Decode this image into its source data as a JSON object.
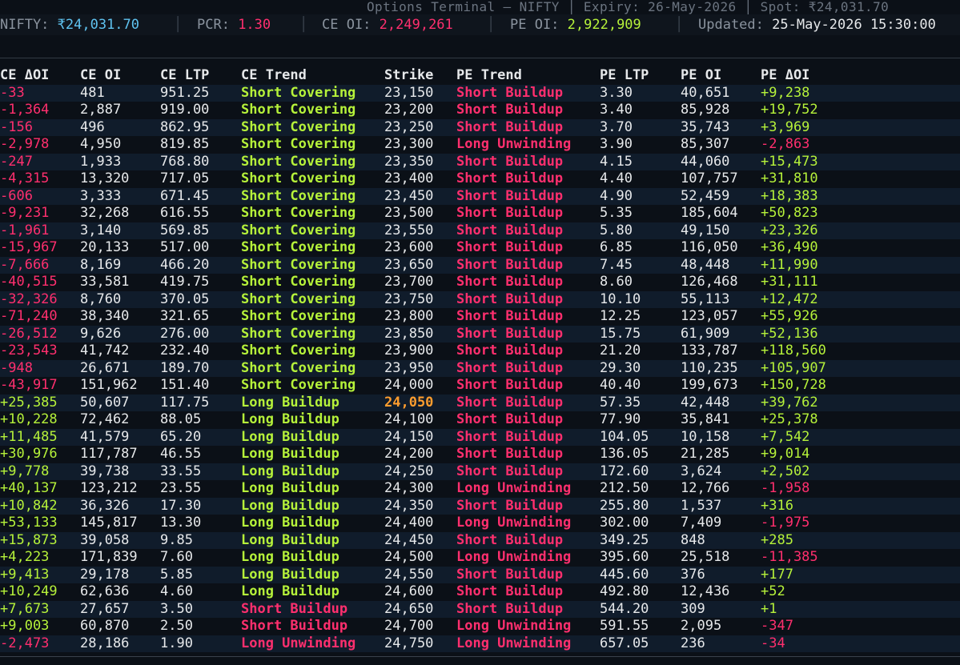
{
  "title": "Options Terminal — NIFTY │ Expiry: 26-May-2026 │ Spot: ₹24,031.70",
  "status": {
    "nifty_label": "NIFTY: ",
    "nifty_value": "₹24,031.70",
    "pcr_label": "PCR: ",
    "pcr_value": "1.30",
    "ce_oi_label": "CE OI: ",
    "ce_oi_value": "2,249,261",
    "pe_oi_label": "PE OI: ",
    "pe_oi_value": "2,922,909",
    "updated_label": "Updated: ",
    "updated_value": "25-May-2026 15:30:00",
    "separator": "│"
  },
  "colors": {
    "positive": "#b6f23a",
    "negative": "#ff2f6e",
    "atm_strike": "#ff9d2e",
    "spot": "#5fc3f0"
  },
  "columns": [
    "CE ΔOI",
    "CE OI",
    "CE LTP",
    "CE Trend",
    "Strike",
    "PE Trend",
    "PE LTP",
    "PE OI",
    "PE ΔOI"
  ],
  "atm_strike": "24,050",
  "rows": [
    [
      "-33",
      "481",
      "951.25",
      "Short Covering",
      "23,150",
      "Short Buildup",
      "3.30",
      "40,651",
      "+9,238"
    ],
    [
      "-1,364",
      "2,887",
      "919.00",
      "Short Covering",
      "23,200",
      "Short Buildup",
      "3.40",
      "85,928",
      "+19,752"
    ],
    [
      "-156",
      "496",
      "862.95",
      "Short Covering",
      "23,250",
      "Short Buildup",
      "3.70",
      "35,743",
      "+3,969"
    ],
    [
      "-2,978",
      "4,950",
      "819.85",
      "Short Covering",
      "23,300",
      "Long Unwinding",
      "3.90",
      "85,307",
      "-2,863"
    ],
    [
      "-247",
      "1,933",
      "768.80",
      "Short Covering",
      "23,350",
      "Short Buildup",
      "4.15",
      "44,060",
      "+15,473"
    ],
    [
      "-4,315",
      "13,320",
      "717.05",
      "Short Covering",
      "23,400",
      "Short Buildup",
      "4.40",
      "107,757",
      "+31,810"
    ],
    [
      "-606",
      "3,333",
      "671.45",
      "Short Covering",
      "23,450",
      "Short Buildup",
      "4.90",
      "52,459",
      "+18,383"
    ],
    [
      "-9,231",
      "32,268",
      "616.55",
      "Short Covering",
      "23,500",
      "Short Buildup",
      "5.35",
      "185,604",
      "+50,823"
    ],
    [
      "-1,961",
      "3,140",
      "569.85",
      "Short Covering",
      "23,550",
      "Short Buildup",
      "5.80",
      "49,150",
      "+23,326"
    ],
    [
      "-15,967",
      "20,133",
      "517.00",
      "Short Covering",
      "23,600",
      "Short Buildup",
      "6.85",
      "116,050",
      "+36,490"
    ],
    [
      "-7,666",
      "8,169",
      "466.20",
      "Short Covering",
      "23,650",
      "Short Buildup",
      "7.45",
      "48,448",
      "+11,990"
    ],
    [
      "-40,515",
      "33,581",
      "419.75",
      "Short Covering",
      "23,700",
      "Short Buildup",
      "8.60",
      "126,468",
      "+31,111"
    ],
    [
      "-32,326",
      "8,760",
      "370.05",
      "Short Covering",
      "23,750",
      "Short Buildup",
      "10.10",
      "55,113",
      "+12,472"
    ],
    [
      "-71,240",
      "38,340",
      "321.65",
      "Short Covering",
      "23,800",
      "Short Buildup",
      "12.25",
      "123,057",
      "+55,926"
    ],
    [
      "-26,512",
      "9,626",
      "276.00",
      "Short Covering",
      "23,850",
      "Short Buildup",
      "15.75",
      "61,909",
      "+52,136"
    ],
    [
      "-23,543",
      "41,742",
      "232.40",
      "Short Covering",
      "23,900",
      "Short Buildup",
      "21.20",
      "133,787",
      "+118,560"
    ],
    [
      "-948",
      "26,671",
      "189.70",
      "Short Covering",
      "23,950",
      "Short Buildup",
      "29.30",
      "110,235",
      "+105,907"
    ],
    [
      "-43,917",
      "151,962",
      "151.40",
      "Short Covering",
      "24,000",
      "Short Buildup",
      "40.40",
      "199,673",
      "+150,728"
    ],
    [
      "+25,385",
      "50,607",
      "117.75",
      "Long Buildup",
      "24,050",
      "Short Buildup",
      "57.35",
      "42,448",
      "+39,762"
    ],
    [
      "+10,228",
      "72,462",
      "88.05",
      "Long Buildup",
      "24,100",
      "Short Buildup",
      "77.90",
      "35,841",
      "+25,378"
    ],
    [
      "+11,485",
      "41,579",
      "65.20",
      "Long Buildup",
      "24,150",
      "Short Buildup",
      "104.05",
      "10,158",
      "+7,542"
    ],
    [
      "+30,976",
      "117,787",
      "46.55",
      "Long Buildup",
      "24,200",
      "Short Buildup",
      "136.05",
      "21,285",
      "+9,014"
    ],
    [
      "+9,778",
      "39,738",
      "33.55",
      "Long Buildup",
      "24,250",
      "Short Buildup",
      "172.60",
      "3,624",
      "+2,502"
    ],
    [
      "+40,137",
      "123,212",
      "23.55",
      "Long Buildup",
      "24,300",
      "Long Unwinding",
      "212.50",
      "12,766",
      "-1,958"
    ],
    [
      "+10,842",
      "36,326",
      "17.30",
      "Long Buildup",
      "24,350",
      "Short Buildup",
      "255.80",
      "1,537",
      "+316"
    ],
    [
      "+53,133",
      "145,817",
      "13.30",
      "Long Buildup",
      "24,400",
      "Long Unwinding",
      "302.00",
      "7,409",
      "-1,975"
    ],
    [
      "+15,873",
      "39,058",
      "9.85",
      "Long Buildup",
      "24,450",
      "Short Buildup",
      "349.25",
      "848",
      "+285"
    ],
    [
      "+4,223",
      "171,839",
      "7.60",
      "Long Buildup",
      "24,500",
      "Long Unwinding",
      "395.60",
      "25,518",
      "-11,385"
    ],
    [
      "+9,413",
      "29,178",
      "5.85",
      "Long Buildup",
      "24,550",
      "Short Buildup",
      "445.60",
      "376",
      "+177"
    ],
    [
      "+10,249",
      "62,636",
      "4.60",
      "Long Buildup",
      "24,600",
      "Short Buildup",
      "492.80",
      "12,436",
      "+52"
    ],
    [
      "+7,673",
      "27,657",
      "3.50",
      "Short Buildup",
      "24,650",
      "Short Buildup",
      "544.20",
      "309",
      "+1"
    ],
    [
      "+9,003",
      "60,870",
      "2.50",
      "Short Buildup",
      "24,700",
      "Long Unwinding",
      "591.55",
      "2,095",
      "-347"
    ],
    [
      "-2,473",
      "28,186",
      "1.90",
      "Long Unwinding",
      "24,750",
      "Long Unwinding",
      "657.05",
      "236",
      "-34"
    ]
  ]
}
